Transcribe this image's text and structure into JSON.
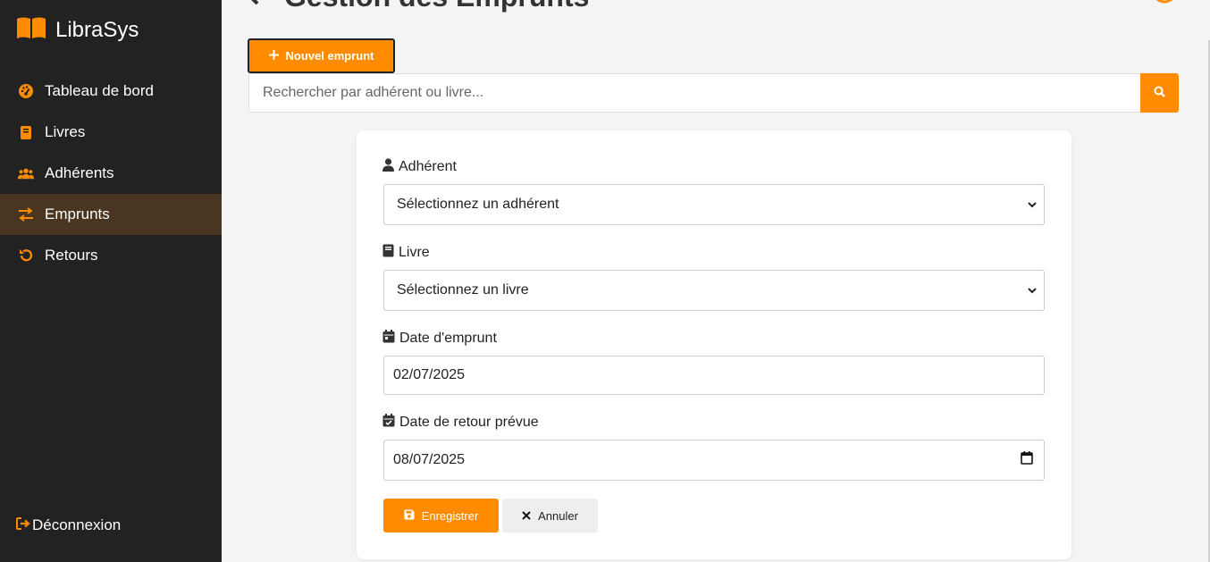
{
  "sidebar": {
    "brand": "LibraSys",
    "items": [
      {
        "label": "Tableau de bord",
        "icon": "tachometer-icon"
      },
      {
        "label": "Livres",
        "icon": "book-icon"
      },
      {
        "label": "Adhérents",
        "icon": "users-icon"
      },
      {
        "label": "Emprunts",
        "icon": "exchange-icon",
        "active": true
      },
      {
        "label": "Retours",
        "icon": "undo-icon"
      }
    ],
    "logout": "Déconnexion"
  },
  "header": {
    "title": "Gestion des Emprunts"
  },
  "toolbar": {
    "new_label": "Nouvel emprunt"
  },
  "search": {
    "placeholder": "Rechercher par adhérent ou livre..."
  },
  "form": {
    "member_label": "Adhérent",
    "member_value": "Sélectionnez un adhérent",
    "book_label": "Livre",
    "book_value": "Sélectionnez un livre",
    "loan_date_label": "Date d'emprunt",
    "loan_date_value": "02/07/2025",
    "return_date_label": "Date de retour prévue",
    "return_date_value": "08/07/2025",
    "save_label": "Enregistrer",
    "cancel_label": "Annuler"
  },
  "colors": {
    "accent": "#ff8c00",
    "sidebar_bg": "#222222",
    "active_bg": "#4a3620"
  }
}
